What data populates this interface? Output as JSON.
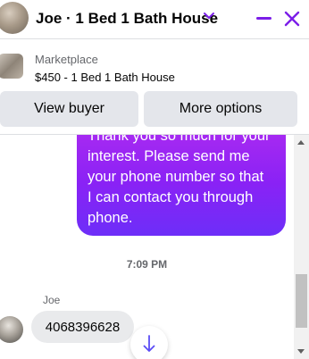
{
  "header": {
    "title": "Joe · 1 Bed 1 Bath House",
    "avatar_icon": "contact-avatar",
    "chevron_icon": "chevron-down-icon",
    "minimize_icon": "minimize-icon",
    "close_icon": "close-icon",
    "accent_color": "#7b1ee8"
  },
  "listing": {
    "source": "Marketplace",
    "title": "$450 - 1 Bed 1 Bath House",
    "buttons": {
      "view_buyer": "View buyer",
      "more_options": "More options"
    }
  },
  "conversation": {
    "messages": [
      {
        "direction": "outgoing",
        "text": "Thank you so much for your\ninterest. Please send me\nyour phone number so that\nI can contact you through\nphone."
      },
      {
        "direction": "incoming",
        "sender": "Joe",
        "text": "4068396628"
      }
    ],
    "timestamp": "7:09 PM",
    "outgoing_gradient": [
      "#b02cf0",
      "#6d2ef8"
    ]
  }
}
